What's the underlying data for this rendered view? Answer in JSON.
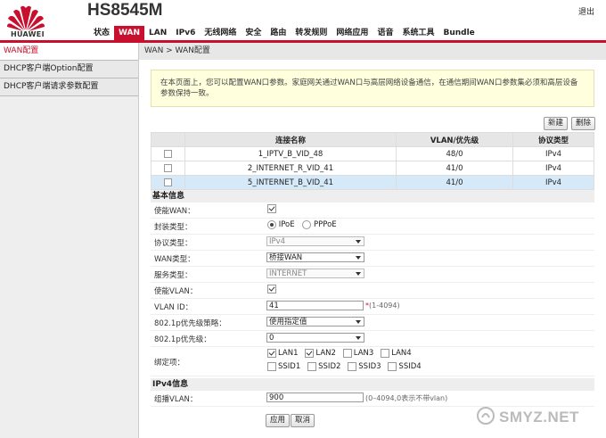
{
  "header": {
    "brand": "HUAWEI",
    "model": "HS8545M",
    "logout": "退出",
    "brand_color": "#c8102e"
  },
  "nav": [
    {
      "label": "状态"
    },
    {
      "label": "WAN",
      "active": true
    },
    {
      "label": "LAN"
    },
    {
      "label": "IPv6"
    },
    {
      "label": "无线网络"
    },
    {
      "label": "安全"
    },
    {
      "label": "路由"
    },
    {
      "label": "转发规则"
    },
    {
      "label": "网络应用"
    },
    {
      "label": "语音"
    },
    {
      "label": "系统工具"
    },
    {
      "label": "Bundle"
    }
  ],
  "sidebar": {
    "items": [
      {
        "label": "WAN配置",
        "active": true
      },
      {
        "label": "DHCP客户端Option配置"
      },
      {
        "label": "DHCP客户端请求参数配置"
      }
    ]
  },
  "breadcrumb": "WAN > WAN配置",
  "notice": "在本页面上，您可以配置WAN口参数。家庭网关通过WAN口与高层网络设备通信，在通信期间WAN口参数集必须和高层设备参数保持一致。",
  "toolbar": {
    "new_label": "新建",
    "delete_label": "删除"
  },
  "wan_table": {
    "headers": [
      "连接名称",
      "VLAN/优先级",
      "协议类型"
    ],
    "rows": [
      {
        "name": "1_IPTV_B_VID_48",
        "vlan": "48/0",
        "proto": "IPv4"
      },
      {
        "name": "2_INTERNET_R_VID_41",
        "vlan": "41/0",
        "proto": "IPv4"
      },
      {
        "name": "5_INTERNET_B_VID_41",
        "vlan": "41/0",
        "proto": "IPv4",
        "selected": true
      }
    ]
  },
  "basic": {
    "section_title": "基本信息",
    "enable_wan_label": "使能WAN：",
    "encap_label": "封装类型：",
    "encap_ipoe": "IPoE",
    "encap_pppoe": "PPPoE",
    "protocol_label": "协议类型：",
    "protocol_value": "IPv4",
    "wan_type_label": "WAN类型：",
    "wan_type_value": "桥接WAN",
    "service_label": "服务类型：",
    "service_value": "INTERNET",
    "enable_vlan_label": "使能VLAN：",
    "vlan_id_label": "VLAN ID：",
    "vlan_id_value": "41",
    "vlan_id_hint": "(1-4094)",
    "p8021_policy_label": "802.1p优先级策略：",
    "p8021_policy_value": "使用指定值",
    "p8021_label": "802.1p优先级：",
    "p8021_value": "0",
    "bind_label": "绑定项：",
    "bind_options": [
      {
        "label": "LAN1",
        "checked": true
      },
      {
        "label": "LAN2",
        "checked": true
      },
      {
        "label": "LAN3",
        "checked": false
      },
      {
        "label": "LAN4",
        "checked": false
      },
      {
        "label": "SSID1",
        "checked": false
      },
      {
        "label": "SSID2",
        "checked": false
      },
      {
        "label": "SSID3",
        "checked": false
      },
      {
        "label": "SSID4",
        "checked": false
      }
    ]
  },
  "ipv4": {
    "section_title": "IPv4信息",
    "mcast_label": "组播VLAN：",
    "mcast_value": "900",
    "mcast_hint": "(0–4094,0表示不带vlan)"
  },
  "actions": {
    "apply_label": "应用",
    "cancel_label": "取消"
  },
  "watermark": "SMYZ.NET"
}
